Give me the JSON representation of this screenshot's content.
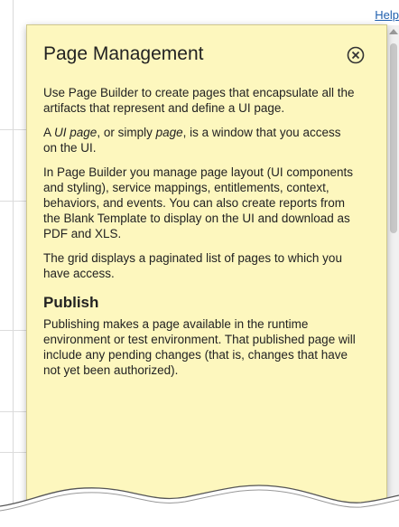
{
  "help_link": "Help",
  "popup": {
    "title": "Page Management",
    "p1": "Use Page Builder to create pages that encapsulate all the artifacts that represent and define a UI page.",
    "p2_a": "A ",
    "p2_em1": "UI page",
    "p2_b": ", or simply ",
    "p2_em2": "page",
    "p2_c": ", is a window that you access on the UI.",
    "p3": "In Page Builder you manage page layout (UI components and styling), service mappings, entitlements, context, behaviors, and events. You can also create reports from the Blank Template to display on the UI and download as PDF and XLS.",
    "p4": "The grid displays a paginated list of pages to which you have access.",
    "section_heading": "Publish",
    "p5": "Publishing makes a page available in the runtime environment or test environment. That published page will include any pending changes (that is, changes that have not yet been authorized)."
  },
  "icons": {
    "close": "close-circle-icon",
    "scroll_up": "chevron-up-icon"
  },
  "colors": {
    "popup_bg": "#fdf7be",
    "link": "#1f5fae"
  }
}
